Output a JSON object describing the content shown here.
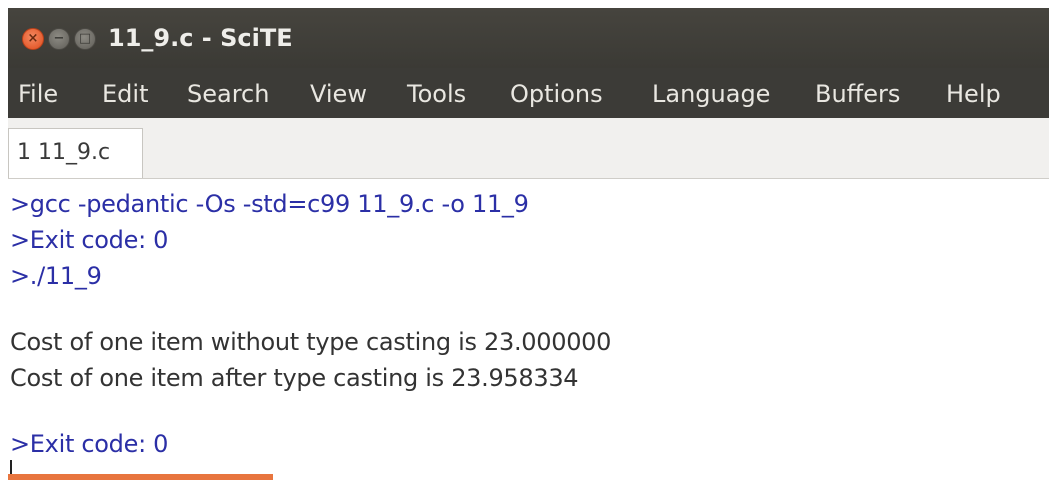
{
  "window": {
    "title": "11_9.c - SciTE",
    "buttons": {
      "close": "×",
      "minimize": "−",
      "maximize": "□"
    }
  },
  "menu": [
    "File",
    "Edit",
    "Search",
    "View",
    "Tools",
    "Options",
    "Language",
    "Buffers",
    "Help"
  ],
  "tab": {
    "label": "1 11_9.c"
  },
  "output": {
    "lines": [
      ">gcc -pedantic -Os -std=c99 11_9.c -o 11_9",
      ">Exit code: 0",
      ">./11_9",
      "",
      "Cost of one item without type casting is 23.000000",
      "Cost of one item after type casting is 23.958334",
      "",
      ">Exit code: 0"
    ]
  },
  "colors": {
    "titlebar": "#3c3b37",
    "command_text": "#2b2fa6",
    "output_text": "#333333",
    "close_button": "#e05a2b",
    "accent_bar": "#e8753e"
  }
}
